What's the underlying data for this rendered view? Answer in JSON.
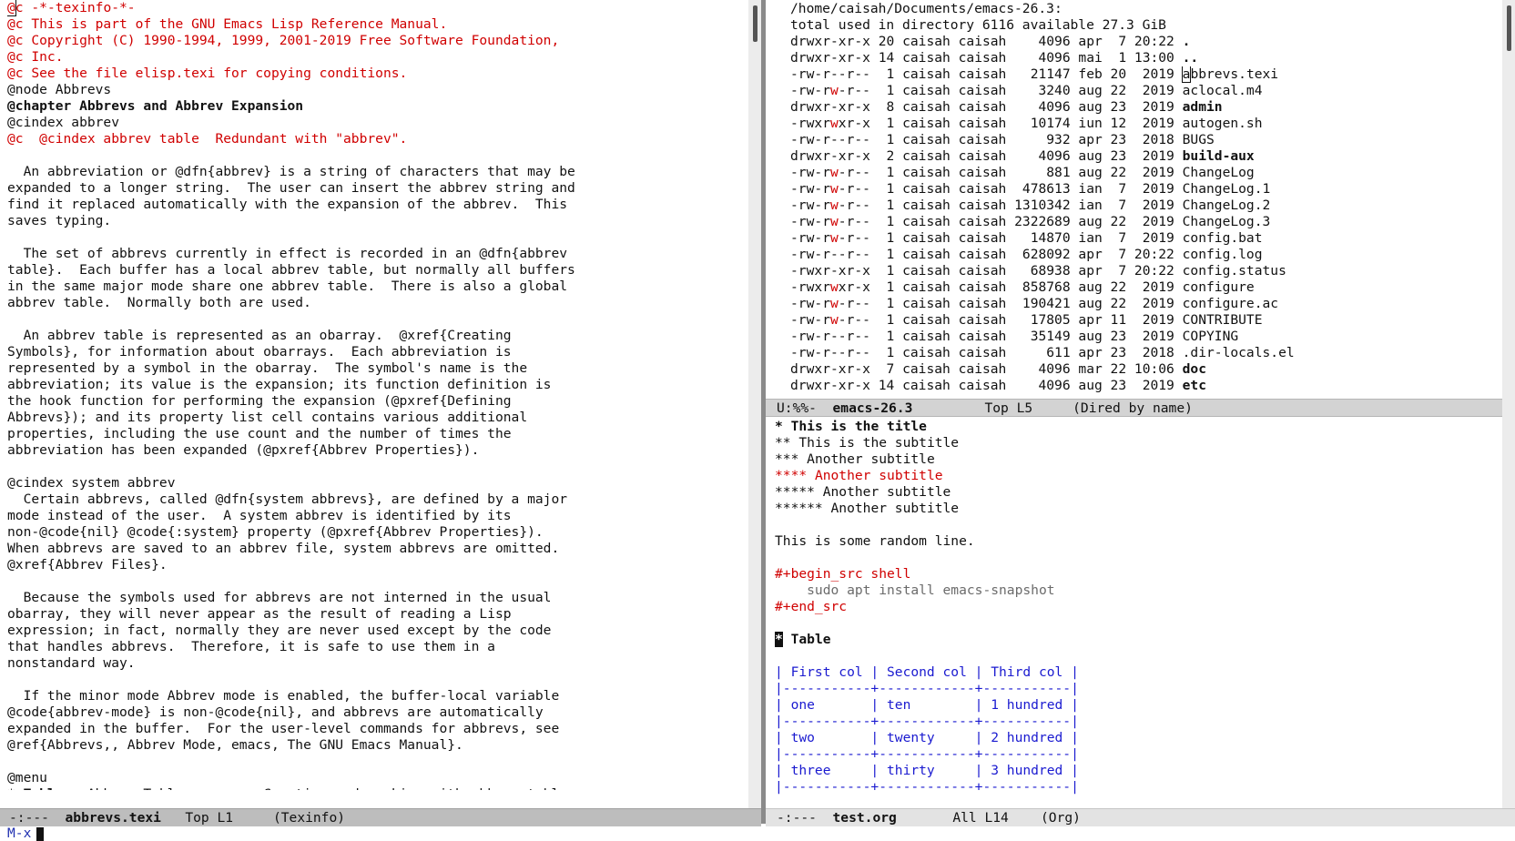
{
  "left_buffer": {
    "lines": [
      [
        {
          "t": "@c -*-texinfo-*-",
          "c": "red"
        }
      ],
      [
        {
          "t": "@c This is part of the GNU Emacs Lisp Reference Manual.",
          "c": "red"
        }
      ],
      [
        {
          "t": "@c Copyright (C) 1990-1994, 1999, 2001-2019 Free Software Foundation,",
          "c": "red"
        }
      ],
      [
        {
          "t": "@c Inc.",
          "c": "red"
        }
      ],
      [
        {
          "t": "@c See the file elisp.texi for copying conditions.",
          "c": "red"
        }
      ],
      [
        {
          "t": "@node Abbrevs",
          "c": ""
        }
      ],
      [
        {
          "t": "@chapter Abbrevs and Abbrev Expansion",
          "c": "bold"
        }
      ],
      [
        {
          "t": "@cindex abbrev",
          "c": ""
        }
      ],
      [
        {
          "t": "@c  @cindex abbrev table  Redundant with \"abbrev\".",
          "c": "red"
        }
      ],
      [
        {
          "t": "",
          "c": ""
        }
      ],
      [
        {
          "t": "  An abbreviation or @dfn{abbrev} is a string of characters that may be",
          "c": ""
        }
      ],
      [
        {
          "t": "expanded to a longer string.  The user can insert the abbrev string and",
          "c": ""
        }
      ],
      [
        {
          "t": "find it replaced automatically with the expansion of the abbrev.  This",
          "c": ""
        }
      ],
      [
        {
          "t": "saves typing.",
          "c": ""
        }
      ],
      [
        {
          "t": "",
          "c": ""
        }
      ],
      [
        {
          "t": "  The set of abbrevs currently in effect is recorded in an @dfn{abbrev",
          "c": ""
        }
      ],
      [
        {
          "t": "table}.  Each buffer has a local abbrev table, but normally all buffers",
          "c": ""
        }
      ],
      [
        {
          "t": "in the same major mode share one abbrev table.  There is also a global",
          "c": ""
        }
      ],
      [
        {
          "t": "abbrev table.  Normally both are used.",
          "c": ""
        }
      ],
      [
        {
          "t": "",
          "c": ""
        }
      ],
      [
        {
          "t": "  An abbrev table is represented as an obarray.  @xref{Creating",
          "c": ""
        }
      ],
      [
        {
          "t": "Symbols}, for information about obarrays.  Each abbreviation is",
          "c": ""
        }
      ],
      [
        {
          "t": "represented by a symbol in the obarray.  The symbol's name is the",
          "c": ""
        }
      ],
      [
        {
          "t": "abbreviation; its value is the expansion; its function definition is",
          "c": ""
        }
      ],
      [
        {
          "t": "the hook function for performing the expansion (@pxref{Defining",
          "c": ""
        }
      ],
      [
        {
          "t": "Abbrevs}); and its property list cell contains various additional",
          "c": ""
        }
      ],
      [
        {
          "t": "properties, including the use count and the number of times the",
          "c": ""
        }
      ],
      [
        {
          "t": "abbreviation has been expanded (@pxref{Abbrev Properties}).",
          "c": ""
        }
      ],
      [
        {
          "t": "",
          "c": ""
        }
      ],
      [
        {
          "t": "@cindex system abbrev",
          "c": ""
        }
      ],
      [
        {
          "t": "  Certain abbrevs, called @dfn{system abbrevs}, are defined by a major",
          "c": ""
        }
      ],
      [
        {
          "t": "mode instead of the user.  A system abbrev is identified by its",
          "c": ""
        }
      ],
      [
        {
          "t": "non-@code{nil} @code{:system} property (@pxref{Abbrev Properties}).",
          "c": ""
        }
      ],
      [
        {
          "t": "When abbrevs are saved to an abbrev file, system abbrevs are omitted.",
          "c": ""
        }
      ],
      [
        {
          "t": "@xref{Abbrev Files}.",
          "c": ""
        }
      ],
      [
        {
          "t": "",
          "c": ""
        }
      ],
      [
        {
          "t": "  Because the symbols used for abbrevs are not interned in the usual",
          "c": ""
        }
      ],
      [
        {
          "t": "obarray, they will never appear as the result of reading a Lisp",
          "c": ""
        }
      ],
      [
        {
          "t": "expression; in fact, normally they are never used except by the code",
          "c": ""
        }
      ],
      [
        {
          "t": "that handles abbrevs.  Therefore, it is safe to use them in a",
          "c": ""
        }
      ],
      [
        {
          "t": "nonstandard way.",
          "c": ""
        }
      ],
      [
        {
          "t": "",
          "c": ""
        }
      ],
      [
        {
          "t": "  If the minor mode Abbrev mode is enabled, the buffer-local variable",
          "c": ""
        }
      ],
      [
        {
          "t": "@code{abbrev-mode} is non-@code{nil}, and abbrevs are automatically",
          "c": ""
        }
      ],
      [
        {
          "t": "expanded in the buffer.  For the user-level commands for abbrevs, see",
          "c": ""
        }
      ],
      [
        {
          "t": "@ref{Abbrevs,, Abbrev Mode, emacs, The GNU Emacs Manual}.",
          "c": ""
        }
      ],
      [
        {
          "t": "",
          "c": ""
        }
      ],
      [
        {
          "t": "@menu",
          "c": ""
        }
      ],
      [
        {
          "t": "* ",
          "c": ""
        },
        {
          "t": "Tables:",
          "c": "bold"
        },
        {
          "t": " Abbrev Tables.        Creating and working with abbrev tables.",
          "c": ""
        }
      ]
    ]
  },
  "left_modeline": {
    "status": "-:---",
    "buffer": "abbrevs.texi",
    "pos": "Top L1",
    "mode": "(Texinfo)"
  },
  "dired": {
    "header": "/home/caisah/Documents/emacs-26.3:",
    "total": "total used in directory 6116 available 27.3 GiB",
    "rows": [
      {
        "perm": "drwxr-xr-x",
        "links": "20",
        "user": "caisah",
        "group": "caisah",
        "size": "4096",
        "month": "apr",
        "day": "7",
        "time": "20:22",
        "name": ".",
        "dir": true
      },
      {
        "perm": "drwxr-xr-x",
        "links": "14",
        "user": "caisah",
        "group": "caisah",
        "size": "4096",
        "month": "mai",
        "day": "1",
        "time": "13:00",
        "name": "..",
        "dir": true
      },
      {
        "perm": "-rw-r--r--",
        "links": "1",
        "user": "caisah",
        "group": "caisah",
        "size": "21147",
        "month": "feb",
        "day": "20",
        "time": "2019",
        "name": "abbrevs.texi",
        "dir": false
      },
      {
        "perm": "-rw-rw-r--",
        "links": "1",
        "user": "caisah",
        "group": "caisah",
        "size": "3240",
        "month": "aug",
        "day": "22",
        "time": "2019",
        "name": "aclocal.m4",
        "dir": false
      },
      {
        "perm": "drwxr-xr-x",
        "links": "8",
        "user": "caisah",
        "group": "caisah",
        "size": "4096",
        "month": "aug",
        "day": "23",
        "time": "2019",
        "name": "admin",
        "dir": true
      },
      {
        "perm": "-rwxrwxr-x",
        "links": "1",
        "user": "caisah",
        "group": "caisah",
        "size": "10174",
        "month": "iun",
        "day": "12",
        "time": "2019",
        "name": "autogen.sh",
        "dir": false
      },
      {
        "perm": "-rw-r--r--",
        "links": "1",
        "user": "caisah",
        "group": "caisah",
        "size": "932",
        "month": "apr",
        "day": "23",
        "time": "2018",
        "name": "BUGS",
        "dir": false
      },
      {
        "perm": "drwxr-xr-x",
        "links": "2",
        "user": "caisah",
        "group": "caisah",
        "size": "4096",
        "month": "aug",
        "day": "23",
        "time": "2019",
        "name": "build-aux",
        "dir": true
      },
      {
        "perm": "-rw-rw-r--",
        "links": "1",
        "user": "caisah",
        "group": "caisah",
        "size": "881",
        "month": "aug",
        "day": "22",
        "time": "2019",
        "name": "ChangeLog",
        "dir": false
      },
      {
        "perm": "-rw-rw-r--",
        "links": "1",
        "user": "caisah",
        "group": "caisah",
        "size": "478613",
        "month": "ian",
        "day": "7",
        "time": "2019",
        "name": "ChangeLog.1",
        "dir": false
      },
      {
        "perm": "-rw-rw-r--",
        "links": "1",
        "user": "caisah",
        "group": "caisah",
        "size": "1310342",
        "month": "ian",
        "day": "7",
        "time": "2019",
        "name": "ChangeLog.2",
        "dir": false
      },
      {
        "perm": "-rw-rw-r--",
        "links": "1",
        "user": "caisah",
        "group": "caisah",
        "size": "2322689",
        "month": "aug",
        "day": "22",
        "time": "2019",
        "name": "ChangeLog.3",
        "dir": false
      },
      {
        "perm": "-rw-rw-r--",
        "links": "1",
        "user": "caisah",
        "group": "caisah",
        "size": "14870",
        "month": "ian",
        "day": "7",
        "time": "2019",
        "name": "config.bat",
        "dir": false
      },
      {
        "perm": "-rw-r--r--",
        "links": "1",
        "user": "caisah",
        "group": "caisah",
        "size": "628092",
        "month": "apr",
        "day": "7",
        "time": "20:22",
        "name": "config.log",
        "dir": false
      },
      {
        "perm": "-rwxr-xr-x",
        "links": "1",
        "user": "caisah",
        "group": "caisah",
        "size": "68938",
        "month": "apr",
        "day": "7",
        "time": "20:22",
        "name": "config.status",
        "dir": false
      },
      {
        "perm": "-rwxrwxr-x",
        "links": "1",
        "user": "caisah",
        "group": "caisah",
        "size": "858768",
        "month": "aug",
        "day": "22",
        "time": "2019",
        "name": "configure",
        "dir": false
      },
      {
        "perm": "-rw-rw-r--",
        "links": "1",
        "user": "caisah",
        "group": "caisah",
        "size": "190421",
        "month": "aug",
        "day": "22",
        "time": "2019",
        "name": "configure.ac",
        "dir": false
      },
      {
        "perm": "-rw-rw-r--",
        "links": "1",
        "user": "caisah",
        "group": "caisah",
        "size": "17805",
        "month": "apr",
        "day": "11",
        "time": "2019",
        "name": "CONTRIBUTE",
        "dir": false
      },
      {
        "perm": "-rw-r--r--",
        "links": "1",
        "user": "caisah",
        "group": "caisah",
        "size": "35149",
        "month": "aug",
        "day": "23",
        "time": "2019",
        "name": "COPYING",
        "dir": false
      },
      {
        "perm": "-rw-r--r--",
        "links": "1",
        "user": "caisah",
        "group": "caisah",
        "size": "611",
        "month": "apr",
        "day": "23",
        "time": "2018",
        "name": ".dir-locals.el",
        "dir": false
      },
      {
        "perm": "drwxr-xr-x",
        "links": "7",
        "user": "caisah",
        "group": "caisah",
        "size": "4096",
        "month": "mar",
        "day": "22",
        "time": "10:06",
        "name": "doc",
        "dir": true
      },
      {
        "perm": "drwxr-xr-x",
        "links": "14",
        "user": "caisah",
        "group": "caisah",
        "size": "4096",
        "month": "aug",
        "day": "23",
        "time": "2019",
        "name": "etc",
        "dir": true
      }
    ]
  },
  "dired_modeline": {
    "status": "U:%%-",
    "buffer": "emacs-26.3",
    "pos": "Top L5",
    "mode": "(Dired by name)"
  },
  "org": {
    "headings": [
      {
        "stars": "*",
        "text": "This is the title",
        "style": "bold"
      },
      {
        "stars": "**",
        "text": "This is the subtitle",
        "style": ""
      },
      {
        "stars": "***",
        "text": "Another subtitle",
        "style": ""
      },
      {
        "stars": "****",
        "text": "Another subtitle",
        "style": "red"
      },
      {
        "stars": "*****",
        "text": "Another subtitle",
        "style": ""
      },
      {
        "stars": "******",
        "text": "Another subtitle",
        "style": ""
      }
    ],
    "random_line": "This is some random line.",
    "src_begin": "#+begin_src shell",
    "src_code": "    sudo apt install emacs-snapshot",
    "src_end": "#+end_src",
    "table_heading": "Table",
    "table_lines": [
      "| First col | Second col | Third col |",
      "|-----------+------------+-----------|",
      "| one       | ten        | 1 hundred |",
      "|-----------+------------+-----------|",
      "| two       | twenty     | 2 hundred |",
      "|-----------+------------+-----------|",
      "| three     | thirty     | 3 hundred |",
      "|-----------+------------+-----------|"
    ]
  },
  "org_modeline": {
    "status": "-:---",
    "buffer": "test.org",
    "pos": "All L14",
    "mode": "(Org)"
  },
  "minibuffer": {
    "prompt": "M-x"
  }
}
